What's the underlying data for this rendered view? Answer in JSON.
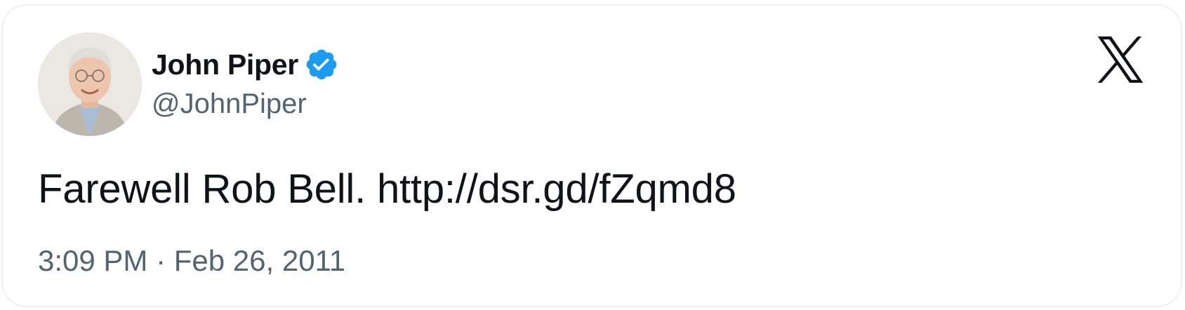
{
  "tweet": {
    "author": {
      "display_name": "John Piper",
      "handle": "@JohnPiper",
      "verified": true,
      "verified_color": "#1d9bf0"
    },
    "text": "Farewell Rob Bell. http://dsr.gd/fZqmd8",
    "timestamp": "3:09 PM · Feb 26, 2011",
    "brand_icon": "x-logo-icon"
  },
  "colors": {
    "primary_text": "#0f1419",
    "secondary_text": "#536471",
    "card_border": "#eef1f4"
  }
}
